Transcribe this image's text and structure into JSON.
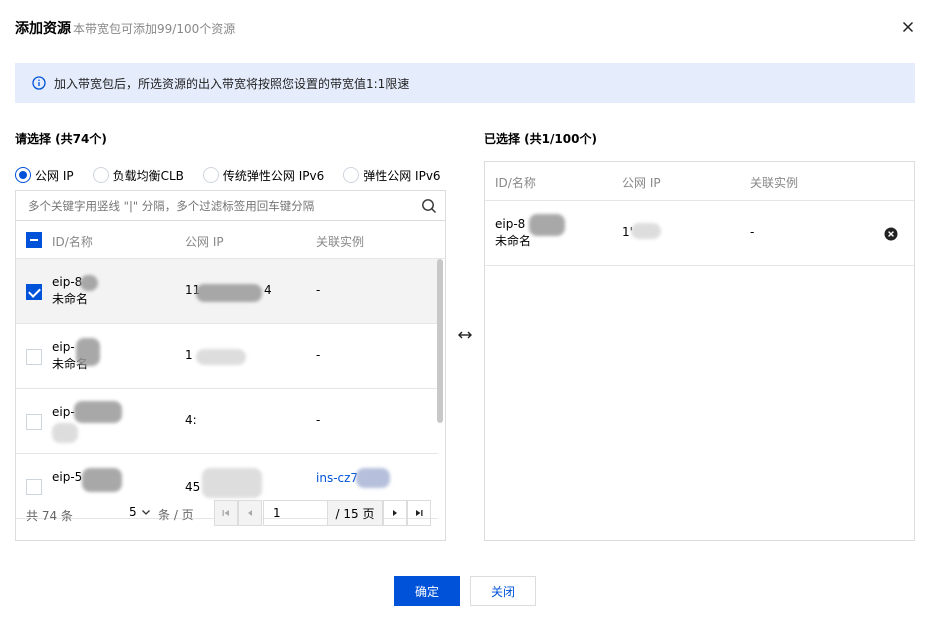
{
  "dialog": {
    "title": "添加资源",
    "subtitle": "本带宽包可添加99/100个资源",
    "notice": "加入带宽包后，所选资源的出入带宽将按照您设置的带宽值1:1限速"
  },
  "left": {
    "label": "请选择 (共74个)",
    "radio_options": [
      {
        "label": "公网 IP",
        "checked": true
      },
      {
        "label": "负载均衡CLB",
        "checked": false
      },
      {
        "label": "传统弹性公网 IPv6",
        "checked": false
      },
      {
        "label": "弹性公网 IPv6",
        "checked": false
      }
    ],
    "search_placeholder": "多个关键字用竖线 \"|\" 分隔，多个过滤标签用回车键分隔",
    "columns": [
      "ID/名称",
      "公网 IP",
      "关联实例"
    ],
    "rows": [
      {
        "id": "eip-8",
        "name": "未命名",
        "ip": "11",
        "ip_tail": "4",
        "instance": "-",
        "checked": true
      },
      {
        "id": "eip-",
        "name": "未命名",
        "ip": "1",
        "ip_tail": "",
        "instance": "-",
        "checked": false
      },
      {
        "id": "eip-",
        "name": "",
        "ip": "4:",
        "ip_tail": "",
        "instance": "-",
        "checked": false
      },
      {
        "id": "eip-5",
        "name": "",
        "ip": "45",
        "ip_tail": "",
        "instance": "ins-cz7",
        "checked": false
      }
    ],
    "pagination": {
      "total": "共 74 条",
      "page_size": "5",
      "page_size_unit": "条 / 页",
      "current_page": "1",
      "total_pages": "/ 15 页"
    }
  },
  "right": {
    "label": "已选择 (共1/100个)",
    "columns": [
      "ID/名称",
      "公网 IP",
      "关联实例"
    ],
    "rows": [
      {
        "id": "eip-8",
        "name": "未命名",
        "ip": "1'",
        "instance": "-"
      }
    ]
  },
  "footer": {
    "confirm": "确定",
    "close": "关闭"
  },
  "colors": {
    "primary": "#0052d9",
    "notice_bg": "#e5edfd"
  }
}
